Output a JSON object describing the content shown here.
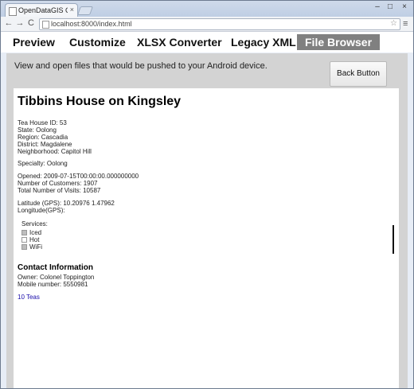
{
  "browser": {
    "tab_title": "OpenDataGIS Ca...",
    "tab_close": "×",
    "url": "localhost:8000/index.html",
    "min": "–",
    "max": "□",
    "close": "×",
    "back": "←",
    "forward": "→",
    "reload": "C",
    "star": "☆",
    "menu": "≡"
  },
  "nav": {
    "tabs": [
      "Preview",
      "Customize",
      "XLSX Converter",
      "Legacy XML",
      "File Browser"
    ],
    "active": "File Browser"
  },
  "page": {
    "description": "View and open files that would be pushed to your Android device.",
    "back_button": "Back Button"
  },
  "record": {
    "title": "Tibbins House on Kingsley",
    "tea_house_id": "Tea House ID: 53",
    "state": "State: Oolong",
    "region": "Region: Cascadia",
    "district": "District: Magdalene",
    "neighborhood": "Neighborhood: Capitol Hill",
    "specialty": "Specialty: Oolong",
    "opened": "Opened: 2009-07-15T00:00:00.000000000",
    "customers": "Number of Customers: 1907",
    "visits": "Total Number of Visits: 10587",
    "latitude": "Latitude (GPS): 10.20976 1.47962",
    "longitude": "Longitude(GPS):",
    "services_label": "Services:",
    "services": [
      {
        "name": "Iced",
        "checked": true
      },
      {
        "name": "Hot",
        "checked": false
      },
      {
        "name": "WiFi",
        "checked": true
      }
    ],
    "contact_heading": "Contact Information",
    "owner": "Owner: Colonel Toppington",
    "mobile": "Mobile number: 5550981",
    "teas_link": "10 Teas"
  }
}
